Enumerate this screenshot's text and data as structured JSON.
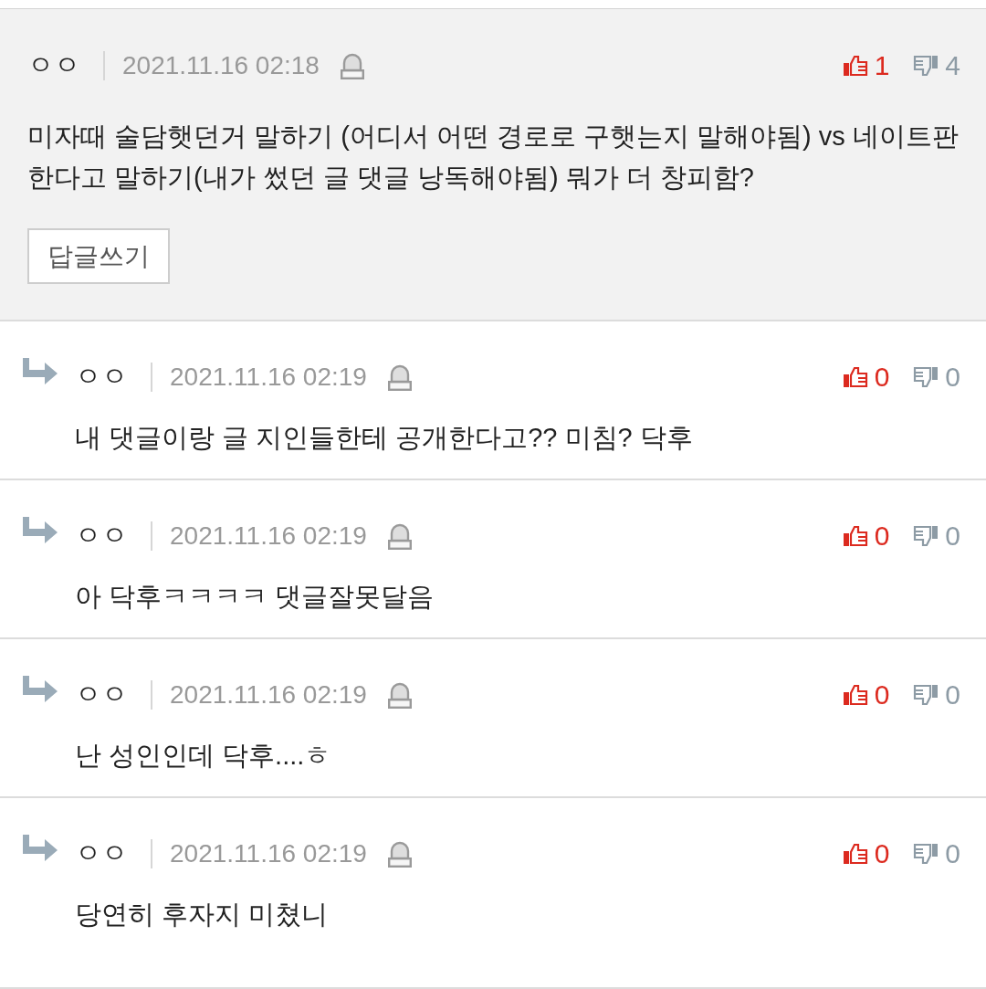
{
  "comment": {
    "author": "ㅇㅇ",
    "date": "2021.11.16 02:18",
    "likes": "1",
    "dislikes": "4",
    "text": "미자때 술담햇던거 말하기 (어디서 어떤 경로로 구햇는지 말해야됨) vs 네이트판 한다고 말하기(내가 썼던 글 댓글 낭독해야됨) 뭐가 더 창피함?",
    "reply_button": "답글쓰기"
  },
  "replies": [
    {
      "author": "ㅇㅇ",
      "date": "2021.11.16 02:19",
      "likes": "0",
      "dislikes": "0",
      "text": "내 댓글이랑 글 지인들한테 공개한다고?? 미침? 닥후"
    },
    {
      "author": "ㅇㅇ",
      "date": "2021.11.16 02:19",
      "likes": "0",
      "dislikes": "0",
      "text": "아 닥후ㅋㅋㅋㅋ 댓글잘못달음"
    },
    {
      "author": "ㅇㅇ",
      "date": "2021.11.16 02:19",
      "likes": "0",
      "dislikes": "0",
      "text": "난 성인인데 닥후....ㅎ"
    },
    {
      "author": "ㅇㅇ",
      "date": "2021.11.16 02:19",
      "likes": "0",
      "dislikes": "0",
      "text": "당연히 후자지 미쳤니"
    }
  ]
}
